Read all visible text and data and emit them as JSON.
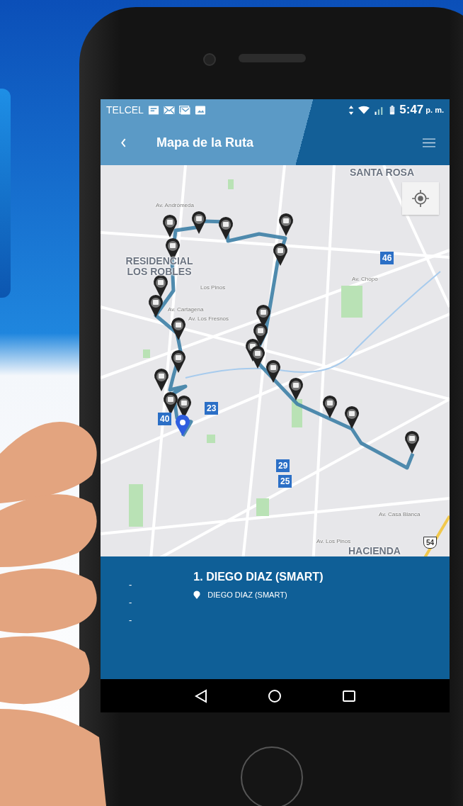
{
  "status_bar": {
    "carrier": "TELCEL",
    "time": "5:47",
    "period": "p. m."
  },
  "app_bar": {
    "title": "Mapa de la Ruta"
  },
  "map": {
    "labels": [
      {
        "text": "SANTA ROSA",
        "kind": "area"
      },
      {
        "text": "Av. Andrómeda",
        "kind": "street"
      },
      {
        "text": "RESIDENCIAL LOS ROBLES",
        "kind": "area"
      },
      {
        "text": "46",
        "kind": "shield"
      },
      {
        "text": "Av. Chopo",
        "kind": "street"
      },
      {
        "text": "Los Pinos",
        "kind": "street"
      },
      {
        "text": "Av. Cartagena",
        "kind": "street"
      },
      {
        "text": "Av. Los Fresnos",
        "kind": "street"
      },
      {
        "text": "23",
        "kind": "shield"
      },
      {
        "text": "40",
        "kind": "shield"
      },
      {
        "text": "29",
        "kind": "shield"
      },
      {
        "text": "25",
        "kind": "shield"
      },
      {
        "text": "Av. Casa Blanca",
        "kind": "street"
      },
      {
        "text": "Av. Los Pinos",
        "kind": "street"
      },
      {
        "text": "54",
        "kind": "highway"
      },
      {
        "text": "HACIENDA",
        "kind": "area"
      }
    ]
  },
  "route_panel": {
    "dashes": [
      "-",
      "-",
      "-"
    ],
    "title": "1. DIEGO DIAZ (SMART)",
    "stop": "DIEGO DIAZ (SMART)"
  }
}
